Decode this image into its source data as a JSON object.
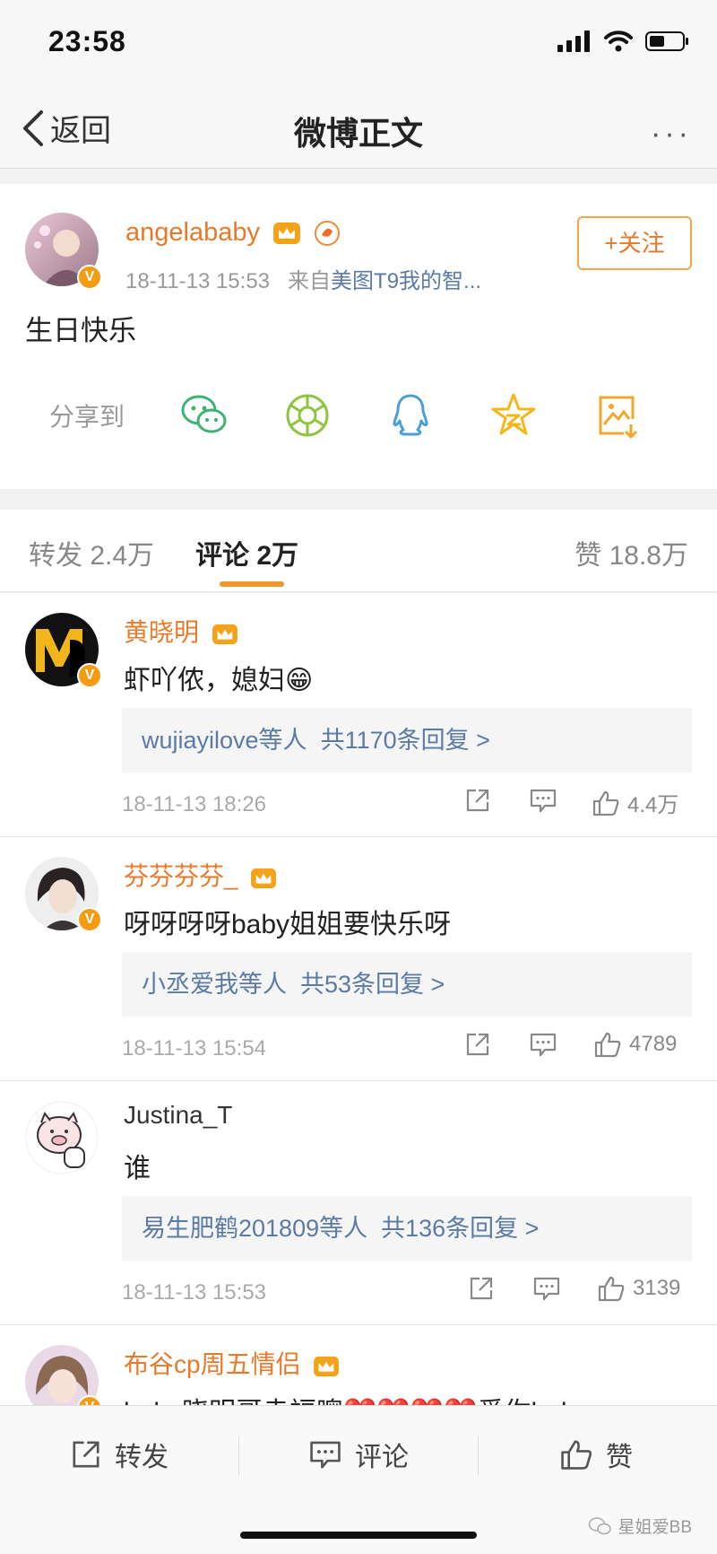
{
  "status": {
    "time": "23:58"
  },
  "nav": {
    "back_label": "返回",
    "title": "微博正文",
    "more_label": "···"
  },
  "post": {
    "author": "angelababy",
    "timestamp": "18-11-13 15:53",
    "source_prefix": "来自",
    "source": "美图T9我的智...",
    "follow_label": "+关注",
    "content": "生日快乐",
    "share_label": "分享到",
    "share_targets": [
      "wechat-icon",
      "moments-icon",
      "qq-icon",
      "qzone-icon",
      "save-image-icon"
    ]
  },
  "tabs": {
    "repost": "转发 2.4万",
    "comments": "评论 2万",
    "likes": "赞 18.8万"
  },
  "comments": [
    {
      "name": "黄晓明",
      "text": "虾吖侬，媳妇😁",
      "reply_users": "wujiayilove等人",
      "reply_count": "共1170条回复 >",
      "time": "18-11-13 18:26",
      "likes": "4.4万"
    },
    {
      "name": "芬芬芬芬_",
      "text": "呀呀呀呀baby姐姐要快乐呀",
      "reply_users": "小丞爱我等人",
      "reply_count": "共53条回复 >",
      "time": "18-11-13 15:54",
      "likes": "4789"
    },
    {
      "name": "Justina_T",
      "text": "谁",
      "reply_users": "易生肥鹤201809等人",
      "reply_count": "共136条回复 >",
      "time": "18-11-13 15:53",
      "likes": "3139"
    },
    {
      "name": "布谷cp周五情侣",
      "text": "baby晓明哥幸福噢❤️❤️❤️❤️爱你baby"
    }
  ],
  "bottom": {
    "repost_label": "转发",
    "comment_label": "评论",
    "like_label": "赞",
    "watermark": "星姐爱BB"
  },
  "colors": {
    "accent": "#e8792a",
    "link": "#5b7aa6",
    "tab_underline": "#f0962e"
  }
}
